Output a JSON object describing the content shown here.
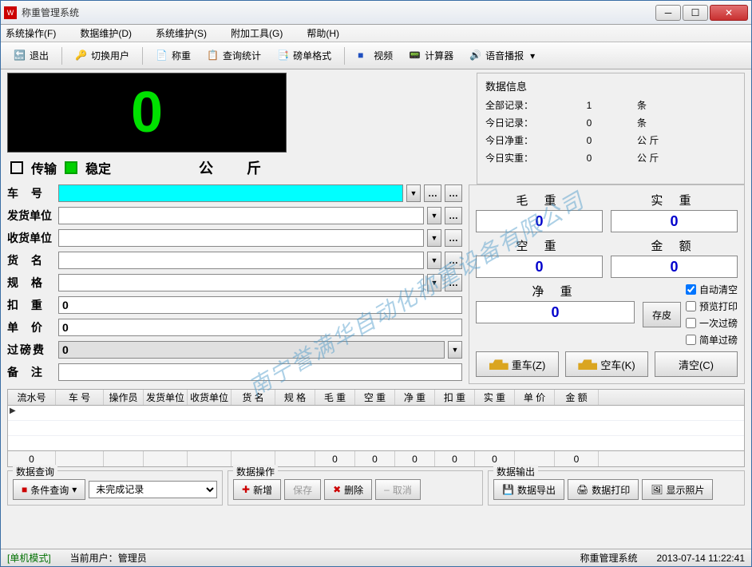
{
  "window": {
    "title": "称重管理系统"
  },
  "menubar": [
    "系统操作(F)",
    "数据维护(D)",
    "系统维护(S)",
    "附加工具(G)",
    "帮助(H)"
  ],
  "toolbar": [
    {
      "label": "退出",
      "icon": "exit"
    },
    {
      "label": "切换用户",
      "icon": "key"
    },
    {
      "label": "称重",
      "icon": "weigh"
    },
    {
      "label": "查询统计",
      "icon": "query"
    },
    {
      "label": "磅单格式",
      "icon": "format"
    },
    {
      "label": "视频",
      "icon": "video"
    },
    {
      "label": "计算器",
      "icon": "calc"
    },
    {
      "label": "语音播报",
      "icon": "voice"
    }
  ],
  "display": {
    "value": "0",
    "transfer": "传输",
    "stable": "稳定",
    "unit": "公　斤"
  },
  "data_info": {
    "title": "数据信息",
    "rows": [
      {
        "lbl": "全部记录：",
        "val": "1",
        "unit": "条"
      },
      {
        "lbl": "今日记录：",
        "val": "0",
        "unit": "条"
      },
      {
        "lbl": "今日净重：",
        "val": "0",
        "unit": "公 斤"
      },
      {
        "lbl": "今日实重：",
        "val": "0",
        "unit": "公 斤"
      }
    ]
  },
  "form": {
    "car_no": {
      "label": "车 号",
      "value": ""
    },
    "sender": {
      "label": "发货单位",
      "value": ""
    },
    "receiver": {
      "label": "收货单位",
      "value": ""
    },
    "goods": {
      "label": "货 名",
      "value": ""
    },
    "spec": {
      "label": "规 格",
      "value": ""
    },
    "deduct": {
      "label": "扣 重",
      "value": "0"
    },
    "price": {
      "label": "单 价",
      "value": "0"
    },
    "fee": {
      "label": "过磅费",
      "value": "0"
    },
    "remark": {
      "label": "备 注",
      "value": ""
    }
  },
  "weights": {
    "gross": {
      "label": "毛  重",
      "val": "0"
    },
    "real": {
      "label": "实  重",
      "val": "0"
    },
    "tare": {
      "label": "空  重",
      "val": "0"
    },
    "amount": {
      "label": "金  额",
      "val": "0"
    },
    "net": {
      "label": "净  重",
      "val": "0"
    },
    "save_tare": "存皮",
    "checks": {
      "auto_clear": "自动清空",
      "preview": "预览打印",
      "once": "一次过磅",
      "simple": "简单过磅"
    },
    "buttons": {
      "heavy": "重车(Z)",
      "empty": "空车(K)",
      "clear": "清空(C)"
    }
  },
  "grid": {
    "headers": [
      "流水号",
      "车  号",
      "操作员",
      "发货单位",
      "收货单位",
      "货  名",
      "规  格",
      "毛  重",
      "空  重",
      "净  重",
      "扣  重",
      "实  重",
      "单  价",
      "金  额"
    ],
    "widths": [
      60,
      60,
      50,
      55,
      55,
      55,
      50,
      50,
      50,
      50,
      50,
      50,
      50,
      55
    ],
    "footer": [
      "0",
      "",
      "",
      "",
      "",
      "",
      "",
      "0",
      "0",
      "0",
      "0",
      "0",
      "",
      "0"
    ]
  },
  "bottom": {
    "query": {
      "title": "数据查询",
      "cond_btn": "条件查询",
      "filter": "未完成记录"
    },
    "ops": {
      "title": "数据操作",
      "add": "新增",
      "save": "保存",
      "del": "删除",
      "cancel": "取消"
    },
    "out": {
      "title": "数据输出",
      "export": "数据导出",
      "print": "数据打印",
      "photo": "显示照片"
    }
  },
  "statusbar": {
    "mode": "[单机模式]",
    "user_lbl": "当前用户：",
    "user": "管理员",
    "sys": "称重管理系统",
    "time": "2013-07-14 11:22:41"
  },
  "watermark": "南宁誉满华自动化称重设备有限公司"
}
